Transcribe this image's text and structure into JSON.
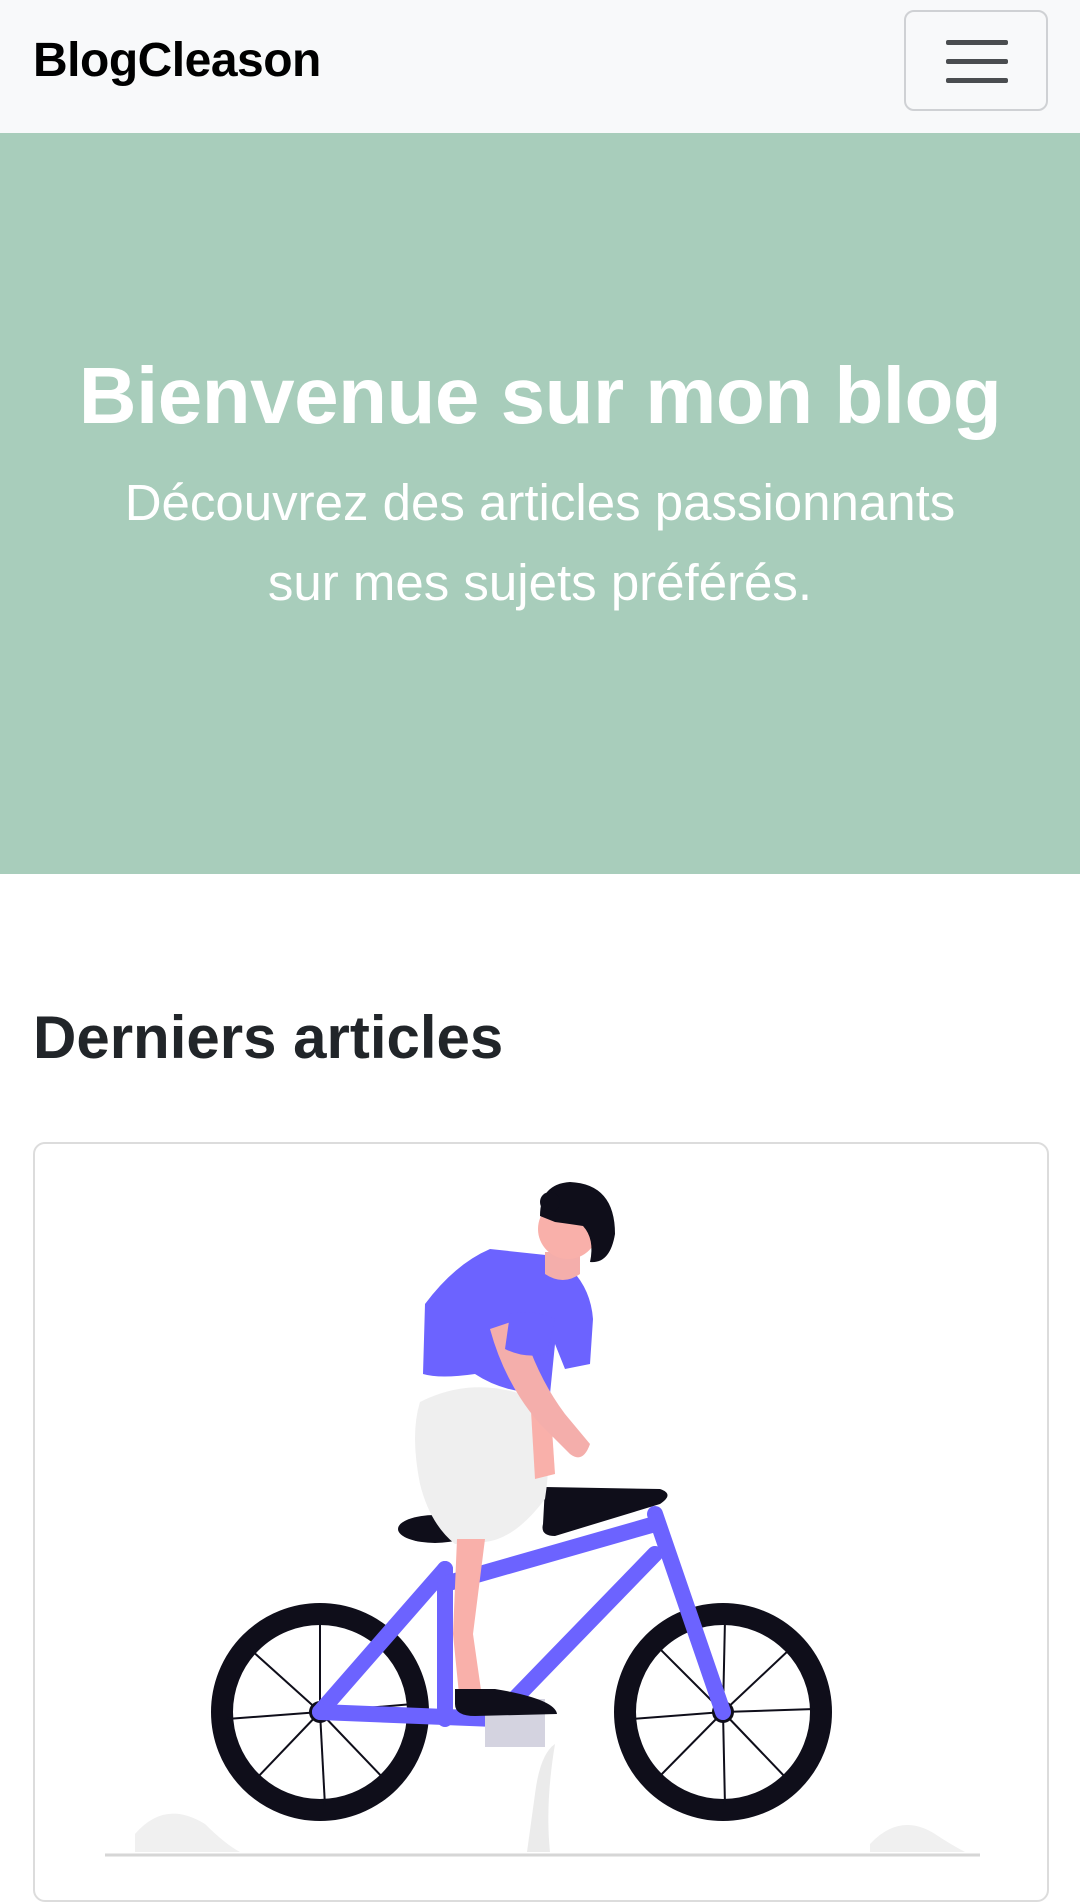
{
  "navbar": {
    "brand": "BlogCleason",
    "toggler_icon": "hamburger-menu-icon"
  },
  "hero": {
    "title": "Bienvenue sur mon blog",
    "subtitle": "Découvrez des articles passionnants sur mes sujets préférés."
  },
  "articles": {
    "section_title": "Derniers articles",
    "cards": [
      {
        "image_icon": "person-riding-bicycle-illustration"
      }
    ]
  },
  "colors": {
    "navbar_bg": "#f8f9fa",
    "hero_bg": "#a8cdbb",
    "illustration_accent": "#6c63ff"
  }
}
